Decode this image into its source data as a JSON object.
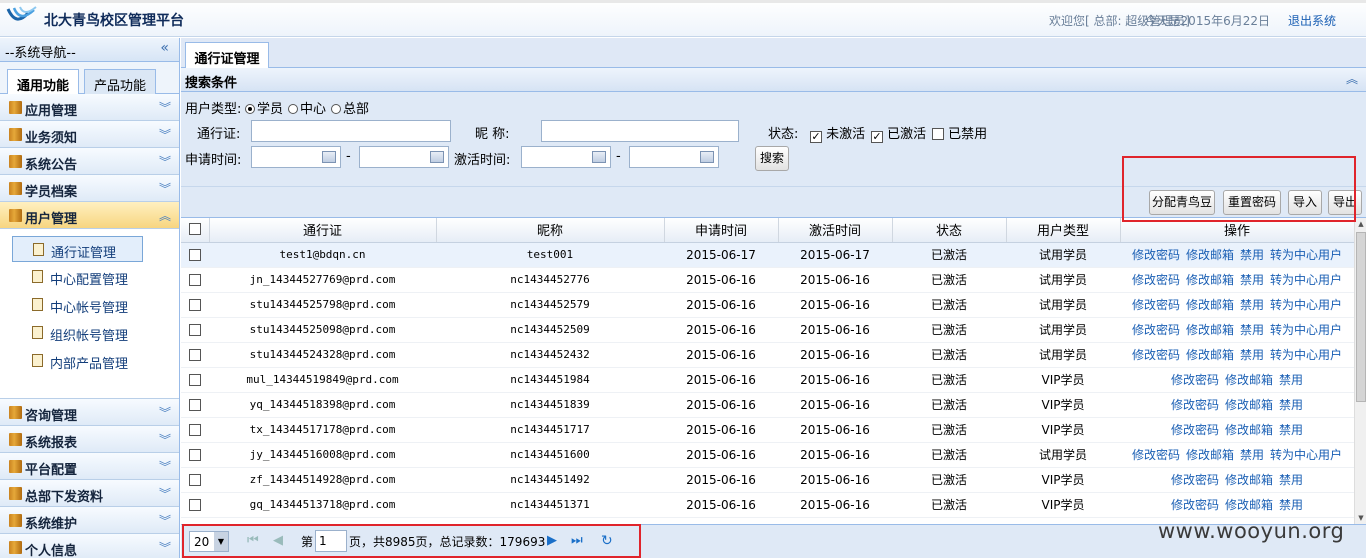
{
  "header": {
    "title": "北大青鸟校区管理平台",
    "welcome": "欢迎您[ 总部:  超级管理员]",
    "date_text": "今天是2015年6月22日",
    "logout": "退出系统"
  },
  "sidebar": {
    "title": "--系统导航--",
    "collapse_icon": "«",
    "tabs": [
      "通用功能",
      "产品功能"
    ],
    "menus_top": [
      "应用管理",
      "业务须知",
      "系统公告",
      "学员档案"
    ],
    "open_menu": "用户管理",
    "submenu": [
      "通行证管理",
      "中心配置管理",
      "中心帐号管理",
      "组织帐号管理",
      "内部产品管理"
    ],
    "menus_bottom": [
      "咨询管理",
      "系统报表",
      "平台配置",
      "总部下发资料",
      "系统维护",
      "个人信息"
    ]
  },
  "main": {
    "tab": "通行证管理",
    "search": {
      "title": "搜索条件",
      "user_type_label": "用户类型:",
      "user_type_options": [
        "学员",
        "中心",
        "总部"
      ],
      "passport_label": "通行证:",
      "nickname_label": "昵    称:",
      "status_label": "状态:",
      "status_options": [
        "未激活",
        "已激活",
        "已禁用"
      ],
      "apply_time_label": "申请时间:",
      "activate_time_label": "激活时间:",
      "dash": "-",
      "search_button": "搜索"
    },
    "toolbar": {
      "assign": "分配青鸟豆",
      "reset_pwd": "重置密码",
      "import": "导入",
      "export": "导出"
    },
    "columns": [
      "通行证",
      "昵称",
      "申请时间",
      "激活时间",
      "状态",
      "用户类型",
      "操作"
    ],
    "rows": [
      {
        "passport": "test1@bdqn.cn",
        "nick": "test001",
        "apply": "2015-06-17",
        "act": "2015-06-17",
        "status": "已激活",
        "type": "试用学员",
        "ops": [
          "修改密码",
          "修改邮箱",
          "禁用",
          "转为中心用户"
        ]
      },
      {
        "passport": "jn_14344527769@prd.com",
        "nick": "nc1434452776",
        "apply": "2015-06-16",
        "act": "2015-06-16",
        "status": "已激活",
        "type": "试用学员",
        "ops": [
          "修改密码",
          "修改邮箱",
          "禁用",
          "转为中心用户"
        ]
      },
      {
        "passport": "stu14344525798@prd.com",
        "nick": "nc1434452579",
        "apply": "2015-06-16",
        "act": "2015-06-16",
        "status": "已激活",
        "type": "试用学员",
        "ops": [
          "修改密码",
          "修改邮箱",
          "禁用",
          "转为中心用户"
        ]
      },
      {
        "passport": "stu14344525098@prd.com",
        "nick": "nc1434452509",
        "apply": "2015-06-16",
        "act": "2015-06-16",
        "status": "已激活",
        "type": "试用学员",
        "ops": [
          "修改密码",
          "修改邮箱",
          "禁用",
          "转为中心用户"
        ]
      },
      {
        "passport": "stu14344524328@prd.com",
        "nick": "nc1434452432",
        "apply": "2015-06-16",
        "act": "2015-06-16",
        "status": "已激活",
        "type": "试用学员",
        "ops": [
          "修改密码",
          "修改邮箱",
          "禁用",
          "转为中心用户"
        ]
      },
      {
        "passport": "mul_14344519849@prd.com",
        "nick": "nc1434451984",
        "apply": "2015-06-16",
        "act": "2015-06-16",
        "status": "已激活",
        "type": "VIP学员",
        "ops": [
          "修改密码",
          "修改邮箱",
          "禁用"
        ]
      },
      {
        "passport": "yq_14344518398@prd.com",
        "nick": "nc1434451839",
        "apply": "2015-06-16",
        "act": "2015-06-16",
        "status": "已激活",
        "type": "VIP学员",
        "ops": [
          "修改密码",
          "修改邮箱",
          "禁用"
        ]
      },
      {
        "passport": "tx_14344517178@prd.com",
        "nick": "nc1434451717",
        "apply": "2015-06-16",
        "act": "2015-06-16",
        "status": "已激活",
        "type": "VIP学员",
        "ops": [
          "修改密码",
          "修改邮箱",
          "禁用"
        ]
      },
      {
        "passport": "jy_14344516008@prd.com",
        "nick": "nc1434451600",
        "apply": "2015-06-16",
        "act": "2015-06-16",
        "status": "已激活",
        "type": "试用学员",
        "ops": [
          "修改密码",
          "修改邮箱",
          "禁用",
          "转为中心用户"
        ]
      },
      {
        "passport": "zf_14344514928@prd.com",
        "nick": "nc1434451492",
        "apply": "2015-06-16",
        "act": "2015-06-16",
        "status": "已激活",
        "type": "VIP学员",
        "ops": [
          "修改密码",
          "修改邮箱",
          "禁用"
        ]
      },
      {
        "passport": "gq_14344513718@prd.com",
        "nick": "nc1434451371",
        "apply": "2015-06-16",
        "act": "2015-06-16",
        "status": "已激活",
        "type": "VIP学员",
        "ops": [
          "修改密码",
          "修改邮箱",
          "禁用"
        ]
      }
    ],
    "pager": {
      "page_size": "20",
      "page_prefix": "第",
      "page": "1",
      "page_suffix": "页，共8985页，总记录数：179693"
    }
  },
  "watermark": "www.wooyun.org",
  "colors": {
    "highlight_box": "#e0242b",
    "link": "#1a5fb4",
    "panel": "#dfe9f6"
  }
}
